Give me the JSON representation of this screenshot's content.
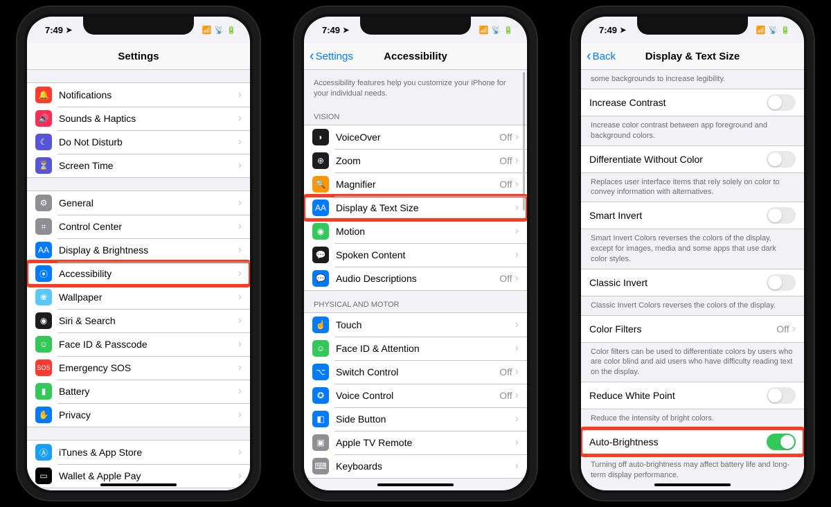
{
  "statusbar": {
    "time": "7:49",
    "loc": "➤",
    "signal": "▮▮▮▮",
    "wifi": "⚪",
    "battery": "■"
  },
  "phone1": {
    "title": "Settings",
    "groups": [
      [
        {
          "icon": "🔔",
          "bg": "#ff3b30",
          "label": "Notifications"
        },
        {
          "icon": "🔊",
          "bg": "#ff2d55",
          "label": "Sounds & Haptics"
        },
        {
          "icon": "☾",
          "bg": "#5856d6",
          "label": "Do Not Disturb"
        },
        {
          "icon": "⏳",
          "bg": "#5856d6",
          "label": "Screen Time"
        }
      ],
      [
        {
          "icon": "⚙︎",
          "bg": "#8e8e93",
          "label": "General"
        },
        {
          "icon": "⌗",
          "bg": "#8e8e93",
          "label": "Control Center"
        },
        {
          "icon": "AA",
          "bg": "#007aff",
          "label": "Display & Brightness"
        },
        {
          "icon": "⦿",
          "bg": "#007aff",
          "label": "Accessibility",
          "highlight": true
        },
        {
          "icon": "❀",
          "bg": "#5ac8fa",
          "label": "Wallpaper"
        },
        {
          "icon": "◉",
          "bg": "#1c1c1e",
          "label": "Siri & Search"
        },
        {
          "icon": "☺",
          "bg": "#34c759",
          "label": "Face ID & Passcode"
        },
        {
          "icon": "SOS",
          "bg": "#ff3b30",
          "label": "Emergency SOS"
        },
        {
          "icon": "▮",
          "bg": "#34c759",
          "label": "Battery"
        },
        {
          "icon": "✋",
          "bg": "#007aff",
          "label": "Privacy"
        }
      ],
      [
        {
          "icon": "Ⓐ",
          "bg": "#1a9ff8",
          "label": "iTunes & App Store"
        },
        {
          "icon": "▭",
          "bg": "#000000",
          "label": "Wallet & Apple Pay"
        }
      ]
    ]
  },
  "phone2": {
    "back": "Settings",
    "title": "Accessibility",
    "intro": "Accessibility features help you customize your iPhone for your individual needs.",
    "sections": [
      {
        "header": "VISION",
        "rows": [
          {
            "icon": "◗",
            "bg": "#1c1c1e",
            "label": "VoiceOver",
            "value": "Off"
          },
          {
            "icon": "⊕",
            "bg": "#1c1c1e",
            "label": "Zoom",
            "value": "Off"
          },
          {
            "icon": "🔍",
            "bg": "#ff9500",
            "label": "Magnifier",
            "value": "Off"
          },
          {
            "icon": "AA",
            "bg": "#007aff",
            "label": "Display & Text Size",
            "highlight": true
          },
          {
            "icon": "◉",
            "bg": "#34c759",
            "label": "Motion"
          },
          {
            "icon": "💬",
            "bg": "#1c1c1e",
            "label": "Spoken Content"
          },
          {
            "icon": "💬",
            "bg": "#007aff",
            "label": "Audio Descriptions",
            "value": "Off"
          }
        ]
      },
      {
        "header": "PHYSICAL AND MOTOR",
        "rows": [
          {
            "icon": "☝",
            "bg": "#007aff",
            "label": "Touch"
          },
          {
            "icon": "☺",
            "bg": "#34c759",
            "label": "Face ID & Attention"
          },
          {
            "icon": "⌥",
            "bg": "#007aff",
            "label": "Switch Control",
            "value": "Off"
          },
          {
            "icon": "✪",
            "bg": "#007aff",
            "label": "Voice Control",
            "value": "Off"
          },
          {
            "icon": "◧",
            "bg": "#007aff",
            "label": "Side Button"
          },
          {
            "icon": "▣",
            "bg": "#8e8e93",
            "label": "Apple TV Remote"
          },
          {
            "icon": "⌨",
            "bg": "#8e8e93",
            "label": "Keyboards"
          }
        ]
      }
    ]
  },
  "phone3": {
    "back": "Back",
    "title": "Display & Text Size",
    "items": [
      {
        "type": "note",
        "text": "some backgrounds to increase legibility."
      },
      {
        "type": "toggle",
        "label": "Increase Contrast",
        "on": false
      },
      {
        "type": "note",
        "text": "Increase color contrast between app foreground and background colors."
      },
      {
        "type": "toggle",
        "label": "Differentiate Without Color",
        "on": false
      },
      {
        "type": "note",
        "text": "Replaces user interface items that rely solely on color to convey information with alternatives."
      },
      {
        "type": "toggle",
        "label": "Smart Invert",
        "on": false
      },
      {
        "type": "note",
        "text": "Smart Invert Colors reverses the colors of the display, except for images, media and some apps that use dark color styles."
      },
      {
        "type": "toggle",
        "label": "Classic Invert",
        "on": false
      },
      {
        "type": "note",
        "text": "Classic Invert Colors reverses the colors of the display."
      },
      {
        "type": "link",
        "label": "Color Filters",
        "value": "Off"
      },
      {
        "type": "note",
        "text": "Color filters can be used to differentiate colors by users who are color blind and aid users who have difficulty reading text on the display."
      },
      {
        "type": "toggle",
        "label": "Reduce White Point",
        "on": false
      },
      {
        "type": "note",
        "text": "Reduce the intensity of bright colors."
      },
      {
        "type": "toggle",
        "label": "Auto-Brightness",
        "on": true,
        "highlight": true
      },
      {
        "type": "note",
        "text": "Turning off auto-brightness may affect battery life and long-term display performance."
      }
    ]
  }
}
